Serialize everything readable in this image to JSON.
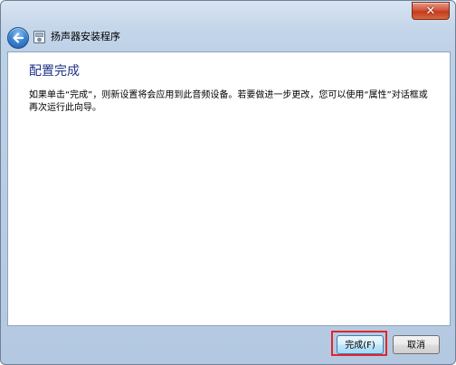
{
  "window": {
    "close_glyph": "✕"
  },
  "navbar": {
    "title": "扬声器安装程序",
    "back_icon": "back-arrow-icon",
    "app_icon": "speaker-setup-icon"
  },
  "content": {
    "heading": "配置完成",
    "paragraph": "如果单击“完成”，则新设置将会应用到此音频设备。若要做进一步更改，您可以使用“属性”对话框或再次运行此向导。"
  },
  "footer": {
    "finish_label": "完成(F)",
    "cancel_label": "取消"
  },
  "colors": {
    "heading": "#1e3287",
    "highlight": "#e0262b",
    "close_button": "#c43b1d"
  }
}
